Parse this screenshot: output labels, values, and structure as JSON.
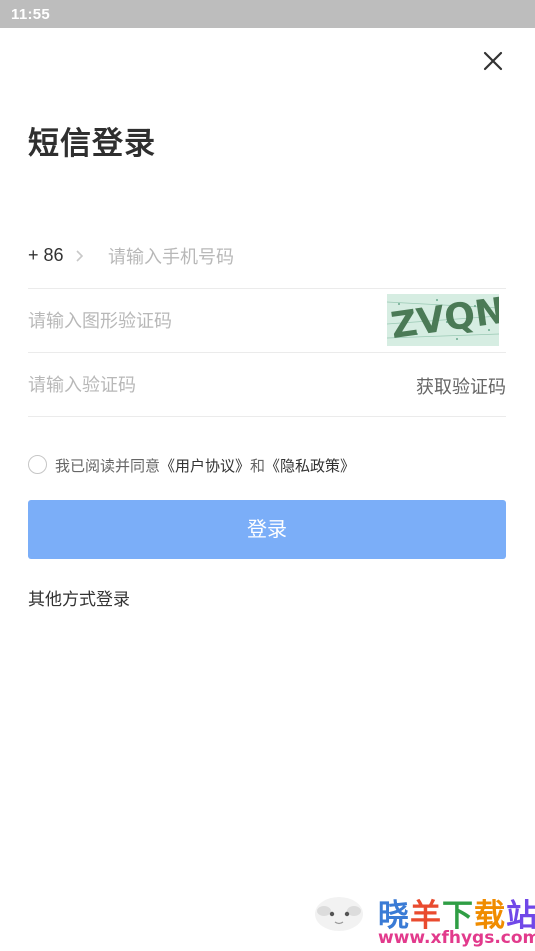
{
  "status_bar": {
    "time": "11:55"
  },
  "header": {
    "title": "短信登录"
  },
  "phone_row": {
    "country_code": "+ 86",
    "placeholder": "请输入手机号码"
  },
  "captcha_row": {
    "placeholder": "请输入图形验证码",
    "captcha_text": "ZVQN"
  },
  "code_row": {
    "placeholder": "请输入验证码",
    "get_code_label": "获取验证码"
  },
  "agreement": {
    "prefix": "我已阅读并同意",
    "user_agreement": "《用户协议》",
    "joiner": "和",
    "privacy_policy": "《隐私政策》",
    "checked": false
  },
  "login_button": {
    "label": "登录"
  },
  "other_login": {
    "label": "其他方式登录"
  },
  "watermark": {
    "brand": "晓羊下载站",
    "url": "www.xfhygs.com"
  },
  "colors": {
    "primary_button": "#7baef8",
    "status_bar": "#bdbdbd",
    "placeholder": "#b8b8b8",
    "watermark_url": "#e23a8c"
  }
}
